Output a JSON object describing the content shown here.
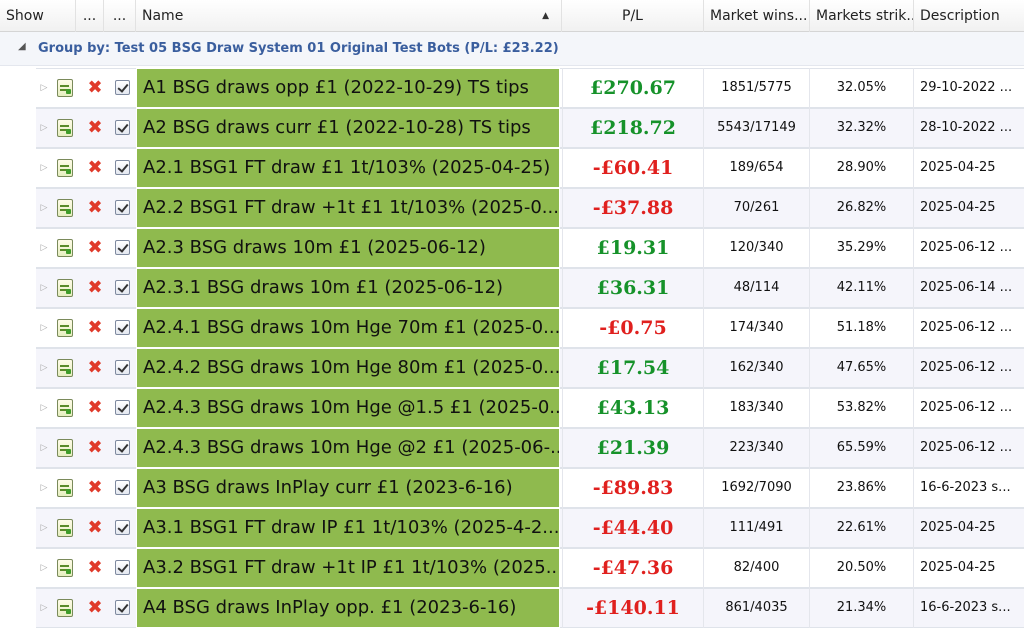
{
  "header": {
    "show": "Show",
    "col2": "...",
    "col3": "...",
    "name": "Name",
    "pl": "P/L",
    "market_wins": "Market wins...",
    "markets_strike": "Markets strik...",
    "description": "Description"
  },
  "group": {
    "label": "Group by: Test 05 BSG Draw System 01 Original Test Bots (P/L: £23.22)"
  },
  "rows": [
    {
      "name": "A1 BSG draws opp £1 (2022-10-29) TS tips",
      "pl": "£270.67",
      "sign": "pos",
      "wins": "1851/5775",
      "strike": "32.05%",
      "desc": "29-10-2022 ..."
    },
    {
      "name": "A2 BSG draws curr £1 (2022-10-28) TS tips",
      "pl": "£218.72",
      "sign": "pos",
      "wins": "5543/17149",
      "strike": "32.32%",
      "desc": "28-10-2022 ..."
    },
    {
      "name": "A2.1 BSG1 FT draw £1 1t/103% (2025-04-25)",
      "pl": "-£60.41",
      "sign": "neg",
      "wins": "189/654",
      "strike": "28.90%",
      "desc": "2025-04-25"
    },
    {
      "name": "A2.2 BSG1 FT draw +1t £1 1t/103% (2025-0...",
      "pl": "-£37.88",
      "sign": "neg",
      "wins": "70/261",
      "strike": "26.82%",
      "desc": "2025-04-25"
    },
    {
      "name": "A2.3 BSG draws 10m £1 (2025-06-12)",
      "pl": "£19.31",
      "sign": "pos",
      "wins": "120/340",
      "strike": "35.29%",
      "desc": "2025-06-12 ..."
    },
    {
      "name": "A2.3.1 BSG draws 10m £1 (2025-06-12)",
      "pl": "£36.31",
      "sign": "pos",
      "wins": "48/114",
      "strike": "42.11%",
      "desc": "2025-06-14 ..."
    },
    {
      "name": "A2.4.1 BSG draws 10m Hge 70m £1 (2025-0...",
      "pl": "-£0.75",
      "sign": "neg",
      "wins": "174/340",
      "strike": "51.18%",
      "desc": "2025-06-12 ..."
    },
    {
      "name": "A2.4.2 BSG draws 10m Hge 80m £1 (2025-0...",
      "pl": "£17.54",
      "sign": "pos",
      "wins": "162/340",
      "strike": "47.65%",
      "desc": "2025-06-12 ..."
    },
    {
      "name": "A2.4.3 BSG draws 10m Hge @1.5 £1 (2025-0...",
      "pl": "£43.13",
      "sign": "pos",
      "wins": "183/340",
      "strike": "53.82%",
      "desc": "2025-06-12 ..."
    },
    {
      "name": "A2.4.3 BSG draws 10m Hge @2 £1 (2025-06-...",
      "pl": "£21.39",
      "sign": "pos",
      "wins": "223/340",
      "strike": "65.59%",
      "desc": "2025-06-12 ..."
    },
    {
      "name": "A3 BSG draws InPlay curr £1 (2023-6-16)",
      "pl": "-£89.83",
      "sign": "neg",
      "wins": "1692/7090",
      "strike": "23.86%",
      "desc": "16-6-2023 s..."
    },
    {
      "name": "A3.1 BSG1 FT draw IP £1 1t/103% (2025-4-2...",
      "pl": "-£44.40",
      "sign": "neg",
      "wins": "111/491",
      "strike": "22.61%",
      "desc": "2025-04-25"
    },
    {
      "name": "A3.2 BSG1 FT draw +1t IP £1 1t/103% (2025...",
      "pl": "-£47.36",
      "sign": "neg",
      "wins": "82/400",
      "strike": "20.50%",
      "desc": "2025-04-25"
    },
    {
      "name": "A4 BSG draws InPlay opp. £1 (2023-6-16)",
      "pl": "-£140.11",
      "sign": "neg",
      "wins": "861/4035",
      "strike": "21.34%",
      "desc": "16-6-2023 s..."
    }
  ],
  "colors": {
    "positive": "#16922a",
    "negative": "#e0201e",
    "name_cell": "#8fba4e",
    "group_text": "#3a5e9e"
  },
  "icons": {
    "expander": "expander-arrow-icon",
    "edit": "edit-document-icon",
    "delete": "delete-x-icon",
    "show": "checkbox-checked-icon",
    "group_toggle": "collapse-triangle-icon",
    "sort": "sort-ascending-icon"
  }
}
